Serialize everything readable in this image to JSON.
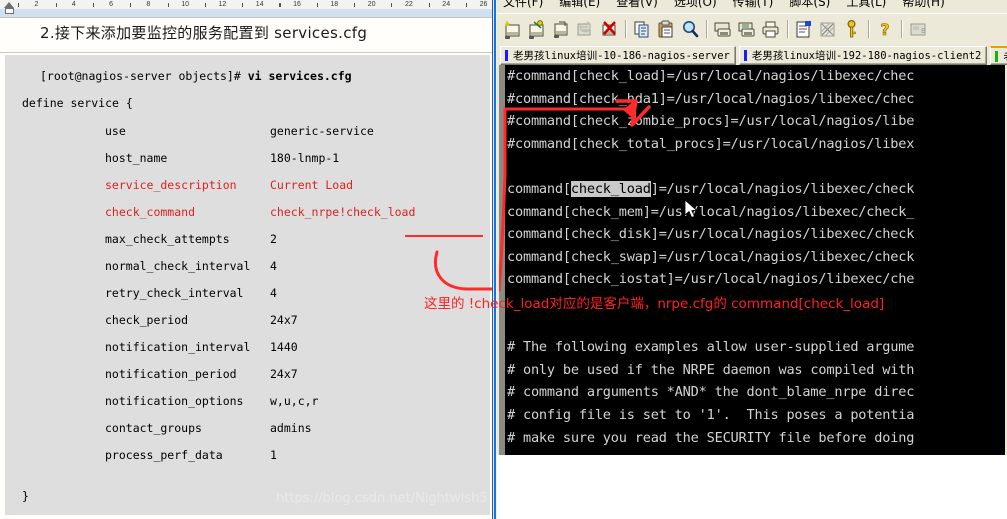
{
  "document": {
    "heading": "2.接下来添加要监控的服务配置到 services.cfg",
    "ruler_numbers": [
      "2",
      "4",
      "6",
      "8",
      "10",
      "12",
      "14",
      "16",
      "18",
      "20",
      "22",
      "24",
      "26"
    ],
    "prompt_line": "[root@nagios-server objects]# ",
    "prompt_command": "vi services.cfg",
    "define_line": "define service {",
    "closing_brace": "}",
    "fields": [
      {
        "key": "use",
        "value": "generic-service",
        "color": "#000000"
      },
      {
        "key": "host_name",
        "value": "180-lnmp-1",
        "color": "#000000"
      },
      {
        "key": "service_description",
        "value": "Current Load",
        "color": "#e02020"
      },
      {
        "key": "check_command",
        "value": "check_nrpe!check_load",
        "color": "#e02020"
      },
      {
        "key": "max_check_attempts",
        "value": "2",
        "color": "#000000"
      },
      {
        "key": "normal_check_interval",
        "value": "4",
        "color": "#000000"
      },
      {
        "key": "retry_check_interval",
        "value": "4",
        "color": "#000000"
      },
      {
        "key": "check_period",
        "value": "24x7",
        "color": "#000000"
      },
      {
        "key": "notification_interval",
        "value": "1440",
        "color": "#000000"
      },
      {
        "key": "notification_period",
        "value": "24x7",
        "color": "#000000"
      },
      {
        "key": "notification_options",
        "value": "w,u,c,r",
        "color": "#000000"
      },
      {
        "key": "contact_groups",
        "value": "admins",
        "color": "#000000"
      },
      {
        "key": "process_perf_data",
        "value": "1",
        "color": "#000000"
      }
    ]
  },
  "terminal_app": {
    "menu": [
      {
        "label": "文件(F)"
      },
      {
        "label": "编辑(E)"
      },
      {
        "label": "查看(V)"
      },
      {
        "label": "选项(O)"
      },
      {
        "label": "传输(T)"
      },
      {
        "label": "脚本(S)"
      },
      {
        "label": "工具(L)"
      },
      {
        "label": "帮助(H)"
      }
    ],
    "toolbar": [
      {
        "name": "new-session-icon"
      },
      {
        "name": "connect-icon"
      },
      {
        "name": "clone-session-icon"
      },
      {
        "name": "reconnect-icon"
      },
      {
        "name": "disconnect-icon"
      },
      {
        "name": "separator"
      },
      {
        "name": "copy-icon"
      },
      {
        "name": "paste-icon"
      },
      {
        "name": "find-icon"
      },
      {
        "name": "separator"
      },
      {
        "name": "log-session-icon"
      },
      {
        "name": "print-screen-icon"
      },
      {
        "name": "print-icon"
      },
      {
        "name": "separator"
      },
      {
        "name": "session-options-icon"
      },
      {
        "name": "global-options-icon"
      },
      {
        "name": "key-icon"
      },
      {
        "name": "separator"
      },
      {
        "name": "help-icon"
      },
      {
        "name": "separator"
      },
      {
        "name": "keymap-icon"
      }
    ],
    "tabs": [
      {
        "label": "老男孩linux培训-10-186-nagios-server",
        "active": false
      },
      {
        "label": "老男孩linux培训-192-180-nagios-client2",
        "active": false
      },
      {
        "label": "老",
        "active": true
      }
    ],
    "console_lines": [
      "#command[check_load]=/usr/local/nagios/libexec/chec",
      "#command[check_hda1]=/usr/local/nagios/libexec/chec",
      "#command[check_zombie_procs]=/usr/local/nagios/libe",
      "#command[check_total_procs]=/usr/local/nagios/libex",
      "",
      "command[check_load]=/usr/local/nagios/libexec/check",
      "command[check_mem]=/usr/local/nagios/libexec/check_",
      "command[check_disk]=/usr/local/nagios/libexec/check",
      "command[check_swap]=/usr/local/nagios/libexec/check",
      "command[check_iostat]=/usr/local/nagios/libexec/che",
      "",
      "",
      "# The following examples allow user-supplied argume",
      "# only be used if the NRPE daemon was compiled with",
      "# command arguments *AND* the dont_blame_nrpe direc",
      "# config file is set to '1'.  This poses a potentia",
      "# make sure you read the SECURITY file before doing"
    ],
    "selected_text": "check_load",
    "annotation": "这里的 !check_load对应的是客户端，nrpe.cfg的 command[check_load]",
    "watermark": "https://blog.csdn.net/Nightwish5"
  },
  "colors": {
    "annotation_red": "#ff2020",
    "doc_red": "#e02020",
    "terminal_bg": "#000000",
    "terminal_fg": "#d4d4d4",
    "chrome_bg": "#ece9d8"
  }
}
